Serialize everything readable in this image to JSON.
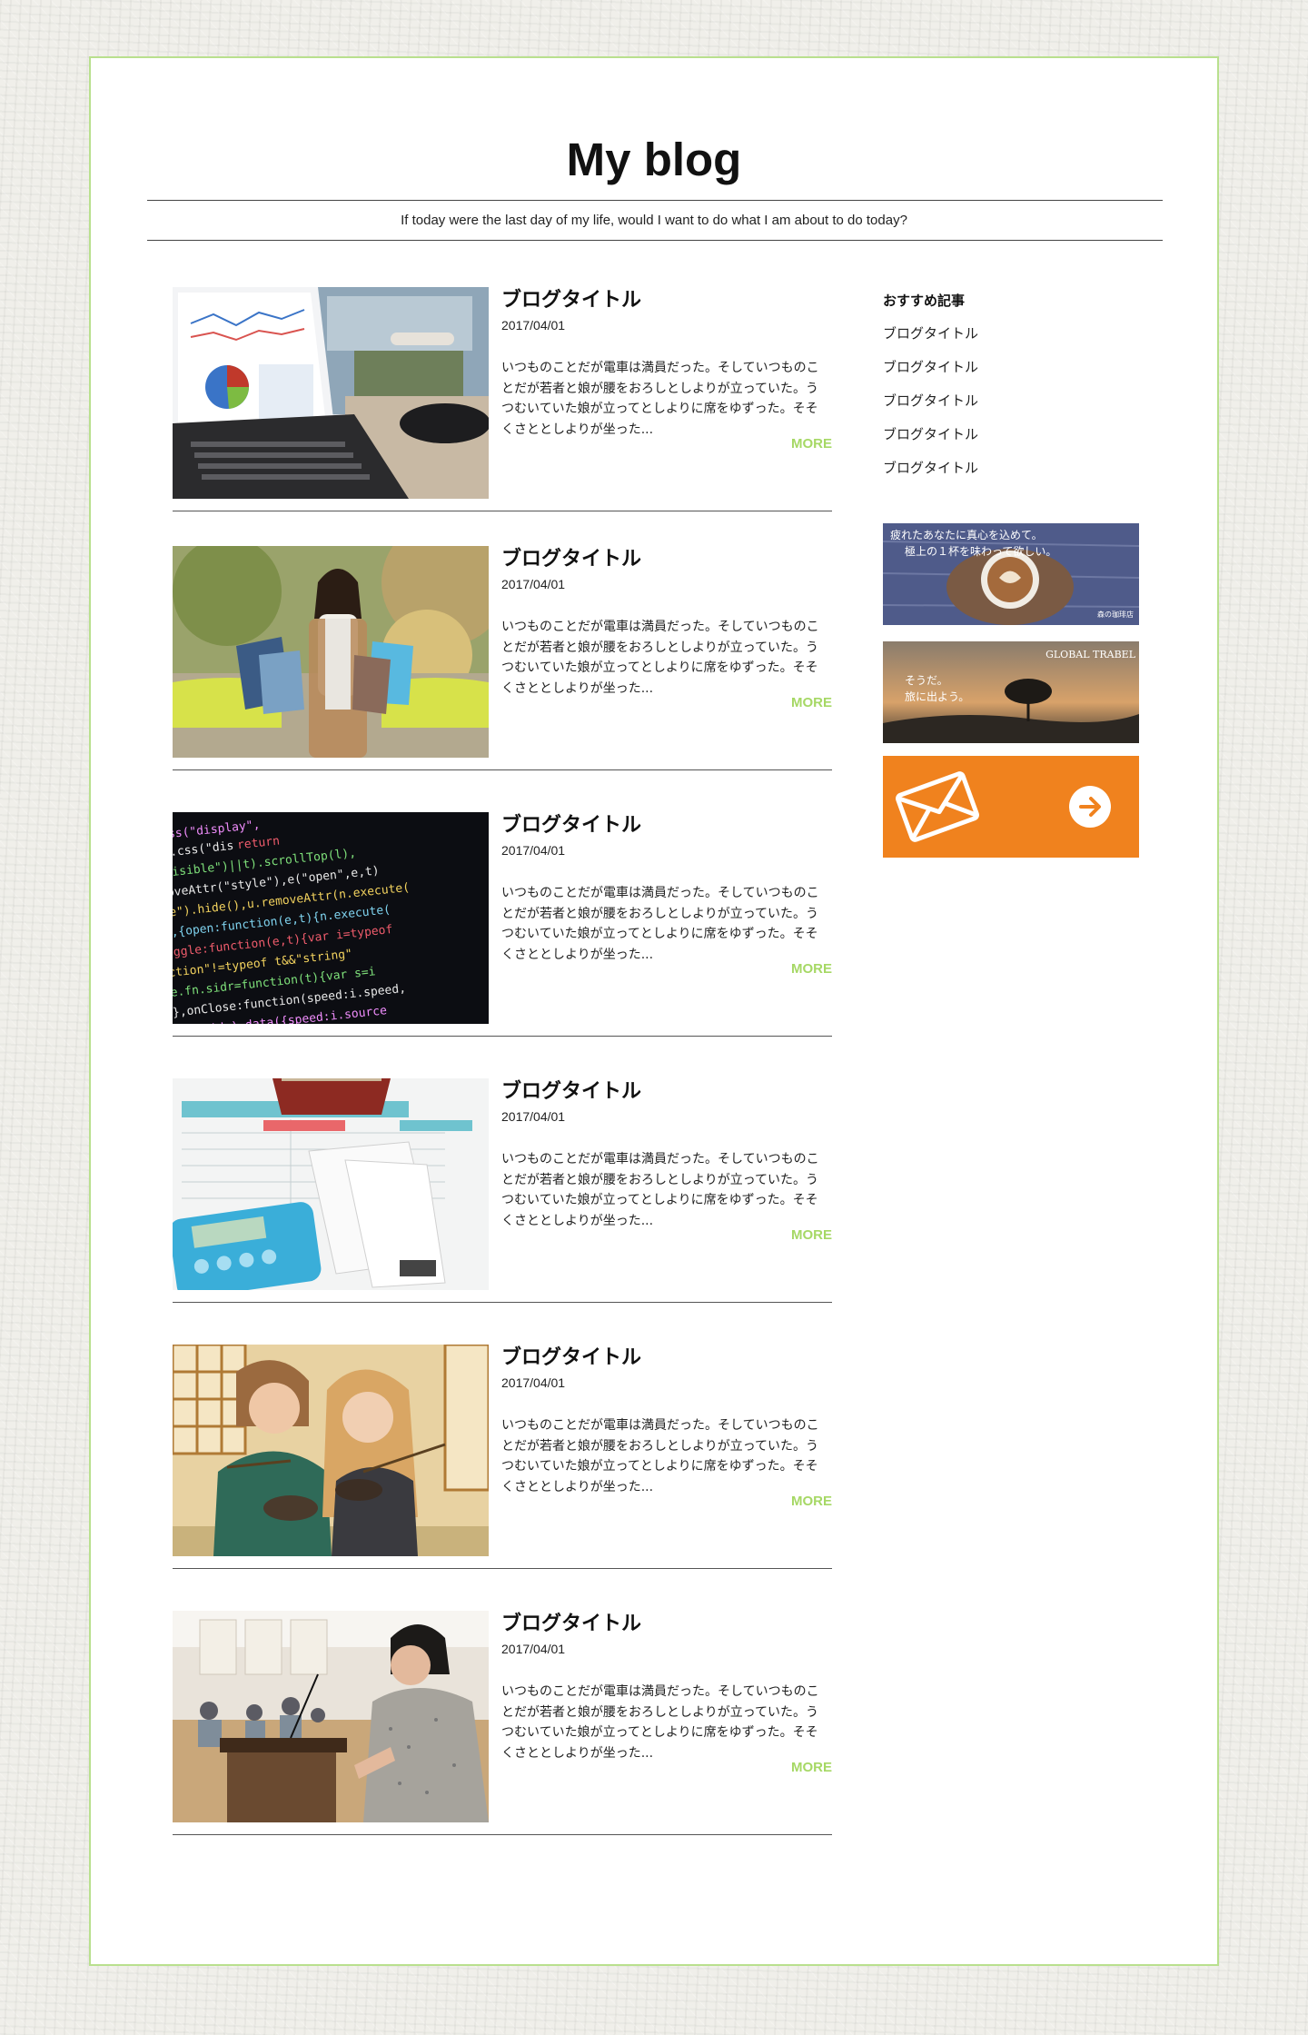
{
  "header": {
    "title": "My blog",
    "tagline": "If today were the last day of my life, would I want to do what I am about to do today?"
  },
  "posts": [
    {
      "title": "ブログタイトル",
      "date": "2017/04/01",
      "excerpt": "いつものことだが電車は満員だった。そしていつものことだが若者と娘が腰をおろしとしよりが立っていた。うつむいていた娘が立ってとしよりに席をゆずった。そそくさととしよりが坐った...",
      "more": "MORE",
      "image": "laptop-chart-photo"
    },
    {
      "title": "ブログタイトル",
      "date": "2017/04/01",
      "excerpt": "いつものことだが電車は満員だった。そしていつものことだが若者と娘が腰をおろしとしよりが立っていた。うつむいていた娘が立ってとしよりに席をゆずった。そそくさととしよりが坐った...",
      "more": "MORE",
      "image": "shopping-woman-photo"
    },
    {
      "title": "ブログタイトル",
      "date": "2017/04/01",
      "excerpt": "いつものことだが電車は満員だった。そしていつものことだが若者と娘が腰をおろしとしよりが立っていた。うつむいていた娘が立ってとしよりに席をゆずった。そそくさととしよりが坐った...",
      "more": "MORE",
      "image": "code-screen-photo"
    },
    {
      "title": "ブログタイトル",
      "date": "2017/04/01",
      "excerpt": "いつものことだが電車は満員だった。そしていつものことだが若者と娘が腰をおろしとしよりが立っていた。うつむいていた娘が立ってとしよりに席をゆずった。そそくさととしよりが坐った...",
      "more": "MORE",
      "image": "budget-receipts-photo"
    },
    {
      "title": "ブログタイトル",
      "date": "2017/04/01",
      "excerpt": "いつものことだが電車は満員だった。そしていつものことだが若者と娘が腰をおろしとしよりが立っていた。うつむいていた娘が立ってとしよりに席をゆずった。そそくさととしよりが坐った...",
      "more": "MORE",
      "image": "friends-noodles-photo"
    },
    {
      "title": "ブログタイトル",
      "date": "2017/04/01",
      "excerpt": "いつものことだが電車は満員だった。そしていつものことだが若者と娘が腰をおろしとしよりが立っていた。うつむいていた娘が立ってとしよりに席をゆずった。そそくさととしよりが坐った...",
      "more": "MORE",
      "image": "lecture-speaker-photo"
    }
  ],
  "sidebar": {
    "heading": "おすすめ記事",
    "items": [
      "ブログタイトル",
      "ブログタイトル",
      "ブログタイトル",
      "ブログタイトル",
      "ブログタイトル"
    ],
    "banners": {
      "coffee": {
        "line1": "疲れたあなたに真心を込めて。",
        "line2": "極上の１杯を味わって欲しい。",
        "credit": "森の珈琲店"
      },
      "travel": {
        "brand": "GLOBAL TRABEL",
        "line1": "そうだ。",
        "line2": "旅に出よう。"
      },
      "mail": {
        "icon": "envelope-icon",
        "arrow": "arrow-right-circle-icon"
      }
    }
  },
  "colors": {
    "accent": "#a6d865",
    "border": "#b9e08e",
    "mail_banner": "#f0821e"
  }
}
